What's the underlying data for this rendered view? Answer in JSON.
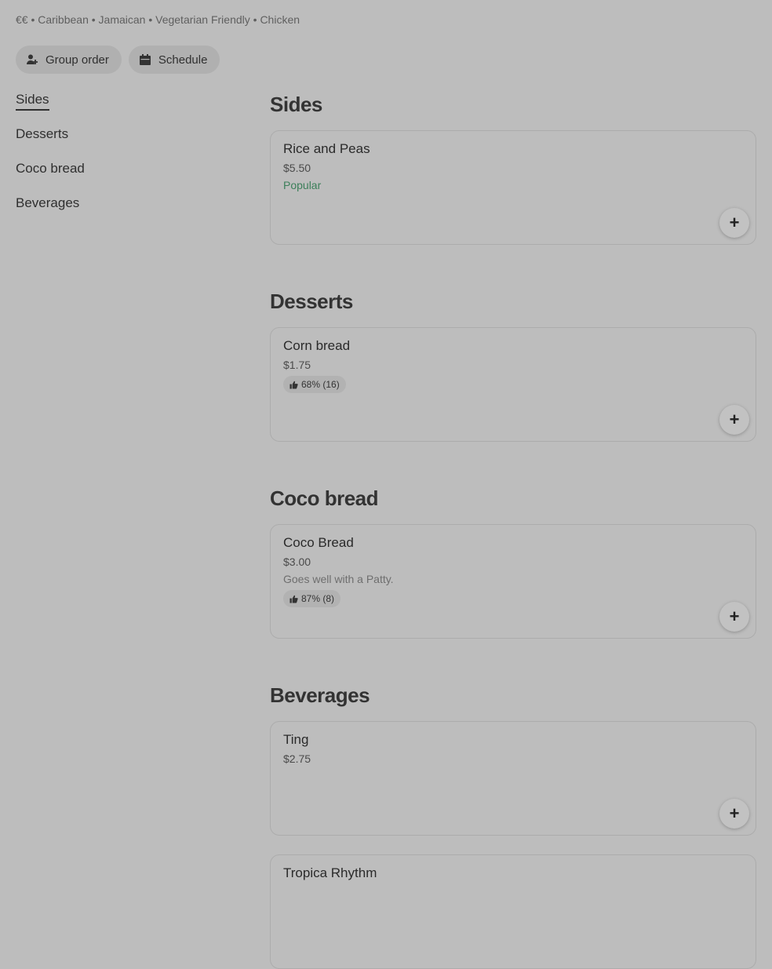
{
  "store": {
    "meta": "€€ • Caribbean • Jamaican • Vegetarian Friendly • Chicken"
  },
  "actions": {
    "group_order": "Group order",
    "schedule": "Schedule"
  },
  "sidebar": {
    "items": [
      {
        "label": "Sides",
        "active": true
      },
      {
        "label": "Desserts"
      },
      {
        "label": "Coco bread"
      },
      {
        "label": "Beverages"
      }
    ]
  },
  "sections": [
    {
      "title": "Sides",
      "items": [
        {
          "name": "Rice and Peas",
          "price": "$5.50",
          "badge": "Popular",
          "add_label": "+"
        }
      ]
    },
    {
      "title": "Desserts",
      "items": [
        {
          "name": "Corn bread",
          "price": "$1.75",
          "rating": "68% (16)",
          "add_label": "+"
        }
      ]
    },
    {
      "title": "Coco bread",
      "items": [
        {
          "name": "Coco Bread",
          "price": "$3.00",
          "description": "Goes well with a Patty.",
          "rating": "87% (8)",
          "add_label": "+"
        }
      ]
    },
    {
      "title": "Beverages",
      "items": [
        {
          "name": "Ting",
          "price": "$2.75",
          "add_label": "+"
        },
        {
          "name": "Tropica Rhythm"
        }
      ]
    }
  ],
  "colors": {
    "background": "#bdbdbd",
    "popular": "#3c7f5a"
  }
}
